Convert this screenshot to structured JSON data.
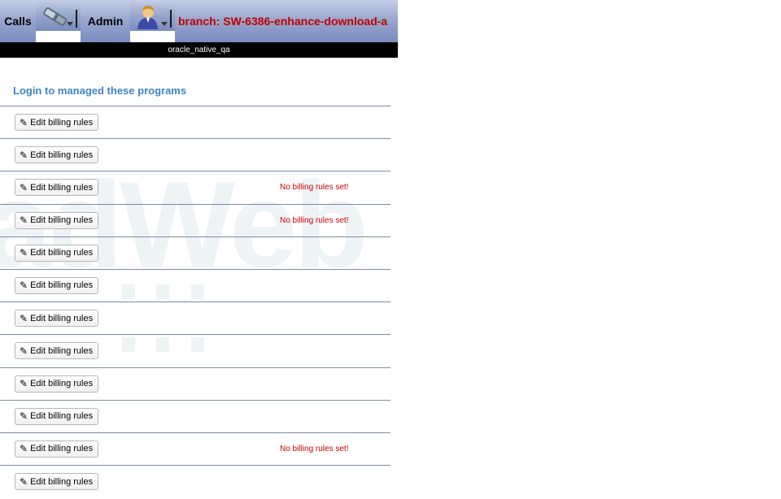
{
  "nav": {
    "calls_label": "Calls",
    "admin_label": "Admin",
    "branch_label": "branch: SW-6386-enhance-download-a",
    "phone_icon": "phone-icon",
    "user_icon": "user-icon"
  },
  "db_name": "oracle_native_qa",
  "heading": "Login to managed these programs",
  "watermark": "adWeb",
  "rows": [
    {
      "button": "Edit billing rules",
      "warning": ""
    },
    {
      "button": "Edit billing rules",
      "warning": ""
    },
    {
      "button": "Edit billing rules",
      "warning": "No billing rules set!"
    },
    {
      "button": "Edit billing rules",
      "warning": "No billing rules set!"
    },
    {
      "button": "Edit billing rules",
      "warning": ""
    },
    {
      "button": "Edit billing rules",
      "warning": ""
    },
    {
      "button": "Edit billing rules",
      "warning": ""
    },
    {
      "button": "Edit billing rules",
      "warning": ""
    },
    {
      "button": "Edit billing rules",
      "warning": ""
    },
    {
      "button": "Edit billing rules",
      "warning": ""
    },
    {
      "button": "Edit billing rules",
      "warning": "No billing rules set!"
    },
    {
      "button": "Edit billing rules",
      "warning": ""
    }
  ],
  "colors": {
    "heading": "#3f84c6",
    "warning": "#cc0000",
    "branch": "#c00000",
    "divider": "#7a8cab"
  }
}
